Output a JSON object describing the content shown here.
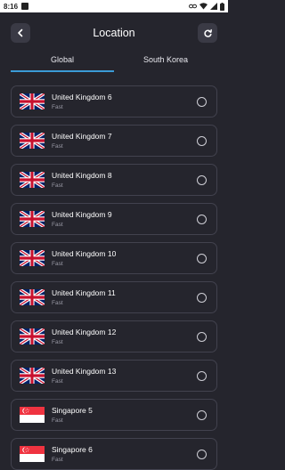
{
  "status": {
    "time": "8:16"
  },
  "header": {
    "title": "Location"
  },
  "tabs": [
    {
      "label": "Global"
    },
    {
      "label": "South Korea"
    }
  ],
  "locations": [
    {
      "name": "United Kingdom 6",
      "speed": "Fast",
      "flag": "uk-flag-icon"
    },
    {
      "name": "United Kingdom 7",
      "speed": "Fast",
      "flag": "uk-flag-icon"
    },
    {
      "name": "United Kingdom 8",
      "speed": "Fast",
      "flag": "uk-flag-icon"
    },
    {
      "name": "United Kingdom 9",
      "speed": "Fast",
      "flag": "uk-flag-icon"
    },
    {
      "name": "United Kingdom 10",
      "speed": "Fast",
      "flag": "uk-flag-icon"
    },
    {
      "name": "United Kingdom 11",
      "speed": "Fast",
      "flag": "uk-flag-icon"
    },
    {
      "name": "United Kingdom 12",
      "speed": "Fast",
      "flag": "uk-flag-icon"
    },
    {
      "name": "United Kingdom 13",
      "speed": "Fast",
      "flag": "uk-flag-icon"
    },
    {
      "name": "Singapore 5",
      "speed": "Fast",
      "flag": "singapore-flag-icon"
    },
    {
      "name": "Singapore 6",
      "speed": "Fast",
      "flag": "singapore-flag-icon"
    }
  ],
  "colors": {
    "background": "#25252d",
    "accent": "#3b9bd6",
    "card_border": "#42424e"
  }
}
